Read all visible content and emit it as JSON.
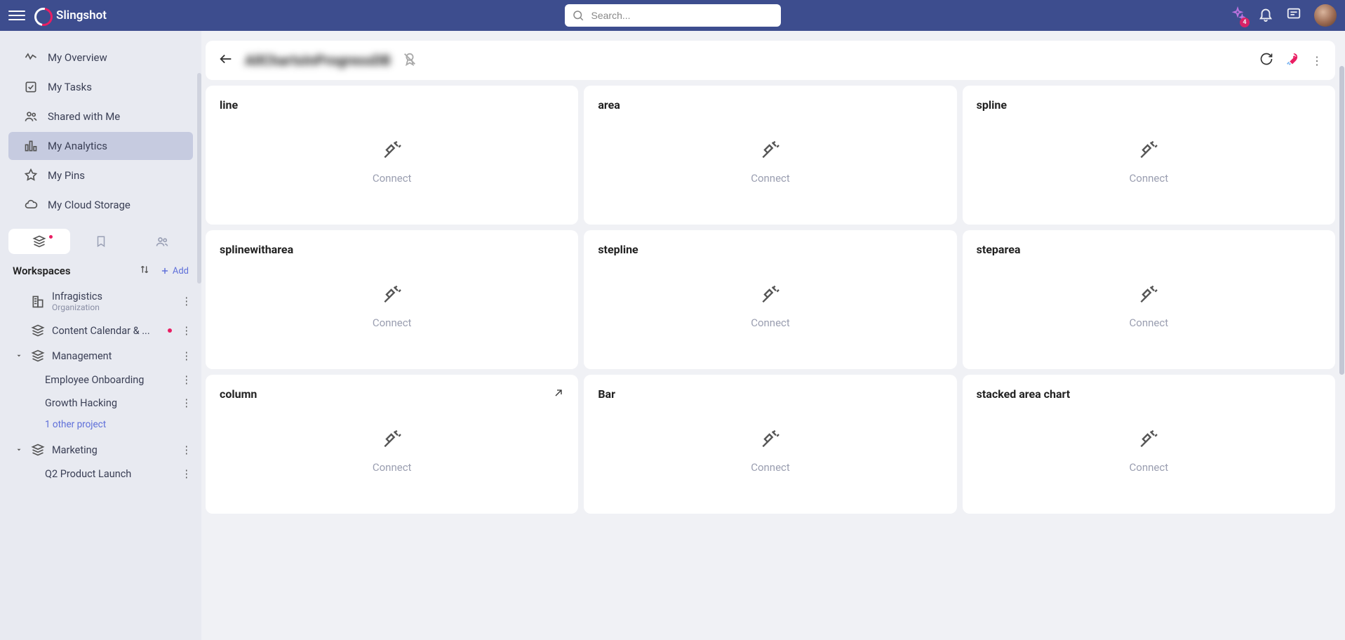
{
  "header": {
    "brand": "Slingshot",
    "search_placeholder": "Search...",
    "ai_badge": "4"
  },
  "sidebar": {
    "nav": [
      {
        "label": "My Overview"
      },
      {
        "label": "My Tasks"
      },
      {
        "label": "Shared with Me"
      },
      {
        "label": "My Analytics"
      },
      {
        "label": "My Pins"
      },
      {
        "label": "My Cloud Storage"
      }
    ],
    "workspaces_label": "Workspaces",
    "add_label": "Add",
    "items": {
      "org_name": "Infragistics",
      "org_sub": "Organization",
      "content_calendar": "Content Calendar & ...",
      "management": "Management",
      "employee_onboarding": "Employee Onboarding",
      "growth_hacking": "Growth Hacking",
      "other_projects": "1 other project",
      "marketing": "Marketing",
      "q2_launch": "Q2 Product Launch"
    }
  },
  "page": {
    "title": "AllChartsInProgressDB",
    "cards": [
      {
        "title": "line",
        "connect": "Connect"
      },
      {
        "title": "area",
        "connect": "Connect"
      },
      {
        "title": "spline",
        "connect": "Connect"
      },
      {
        "title": "splinewitharea",
        "connect": "Connect"
      },
      {
        "title": "stepline",
        "connect": "Connect"
      },
      {
        "title": "steparea",
        "connect": "Connect"
      },
      {
        "title": "column",
        "connect": "Connect",
        "expand": true
      },
      {
        "title": "Bar",
        "connect": "Connect"
      },
      {
        "title": "stacked area chart",
        "connect": "Connect"
      }
    ]
  }
}
